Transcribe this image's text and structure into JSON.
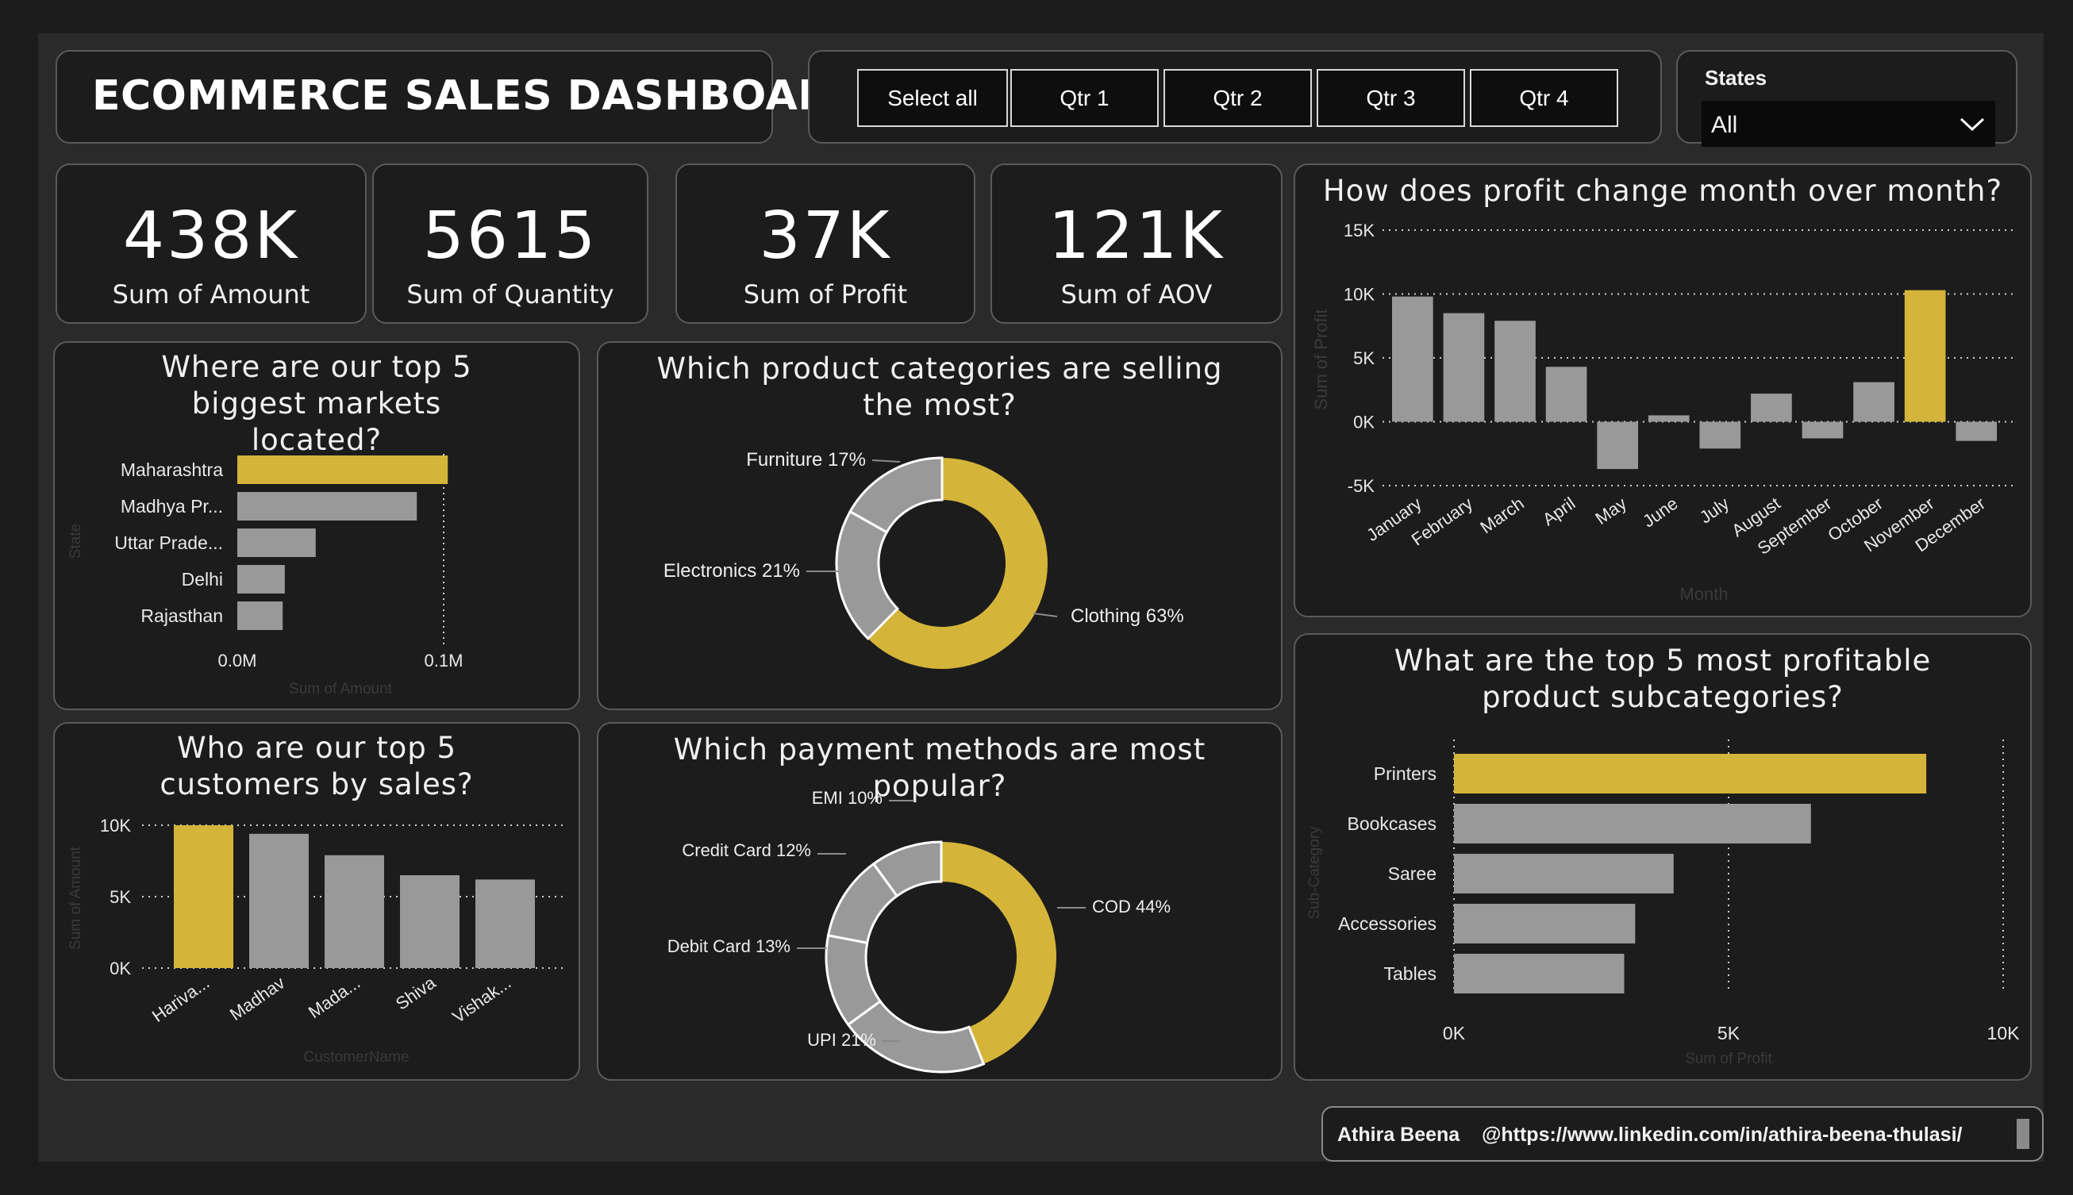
{
  "header": {
    "title": "ECOMMERCE SALES DASHBOARD"
  },
  "quarters": [
    "Select all",
    "Qtr 1",
    "Qtr 2",
    "Qtr 3",
    "Qtr 4"
  ],
  "states_slicer": {
    "label": "States",
    "selected": "All"
  },
  "kpis": [
    {
      "value": "438K",
      "label": "Sum of Amount"
    },
    {
      "value": "5615",
      "label": "Sum of Quantity"
    },
    {
      "value": "37K",
      "label": "Sum of Profit"
    },
    {
      "value": "121K",
      "label": "Sum of AOV"
    }
  ],
  "colors": {
    "highlight": "#d4b53a",
    "bar": "#999999",
    "background": "#1c1c1c"
  },
  "chart_data": [
    {
      "id": "markets",
      "type": "bar",
      "orientation": "horizontal",
      "title": "Where are our top 5 biggest markets located?",
      "xlabel": "Sum of Amount",
      "ylabel": "State",
      "categories": [
        "Maharashtra",
        "Madhya Pr...",
        "Uttar Prade...",
        "Delhi",
        "Rajasthan"
      ],
      "values": [
        102000,
        87000,
        38000,
        23000,
        22000
      ],
      "xlim": [
        0,
        0.1
      ],
      "xticks": [
        "0.0M",
        "0.1M"
      ],
      "highlight_index": 0
    },
    {
      "id": "categories",
      "type": "pie",
      "donut": true,
      "title": "Which product categories are selling the most?",
      "labels": [
        "Clothing",
        "Electronics",
        "Furniture"
      ],
      "values": [
        63,
        21,
        17
      ],
      "data_labels": [
        "Clothing 63%",
        "Electronics 21%",
        "Furniture 17%"
      ],
      "highlight_index": 0
    },
    {
      "id": "profit_month",
      "type": "bar",
      "title": "How does profit change month over month?",
      "xlabel": "Month",
      "ylabel": "Sum of Profit",
      "categories": [
        "January",
        "February",
        "March",
        "April",
        "May",
        "June",
        "July",
        "August",
        "September",
        "October",
        "November",
        "December"
      ],
      "values": [
        9800,
        8500,
        7900,
        4300,
        -3700,
        500,
        -2100,
        2200,
        -1300,
        3100,
        10300,
        -1500
      ],
      "ylim": [
        -5000,
        15000
      ],
      "yticks": [
        "-5K",
        "0K",
        "5K",
        "10K",
        "15K"
      ],
      "highlight_index": 10
    },
    {
      "id": "customers",
      "type": "bar",
      "title": "Who are our top 5 customers by sales?",
      "xlabel": "CustomerName",
      "ylabel": "Sum of Amount",
      "categories": [
        "Hariva...",
        "Madhav",
        "Mada...",
        "Shiva",
        "Vishak..."
      ],
      "values": [
        10000,
        9400,
        7900,
        6500,
        6200
      ],
      "ylim": [
        0,
        10000
      ],
      "yticks": [
        "0K",
        "5K",
        "10K"
      ],
      "highlight_index": 0
    },
    {
      "id": "payments",
      "type": "pie",
      "donut": true,
      "title": "Which payment methods are most popular?",
      "labels": [
        "COD",
        "UPI",
        "Debit Card",
        "Credit Card",
        "EMI"
      ],
      "values": [
        44,
        21,
        13,
        12,
        10
      ],
      "data_labels": [
        "COD 44%",
        "UPI 21%",
        "Debit Card 13%",
        "Credit Card 12%",
        "EMI 10%"
      ],
      "highlight_index": 0
    },
    {
      "id": "subcategories",
      "type": "bar",
      "orientation": "horizontal",
      "title": "What are the top 5 most profitable product subcategories?",
      "xlabel": "Sum of Profit",
      "ylabel": "Sub-Category",
      "categories": [
        "Printers",
        "Bookcases",
        "Saree",
        "Accessories",
        "Tables"
      ],
      "values": [
        8600,
        6500,
        4000,
        3300,
        3100
      ],
      "xlim": [
        0,
        10000
      ],
      "xticks": [
        "0K",
        "5K",
        "10K"
      ],
      "highlight_index": 0
    }
  ],
  "footer": {
    "author": "Athira Beena",
    "link": "@https://www.linkedin.com/in/athira-beena-thulasi/"
  }
}
